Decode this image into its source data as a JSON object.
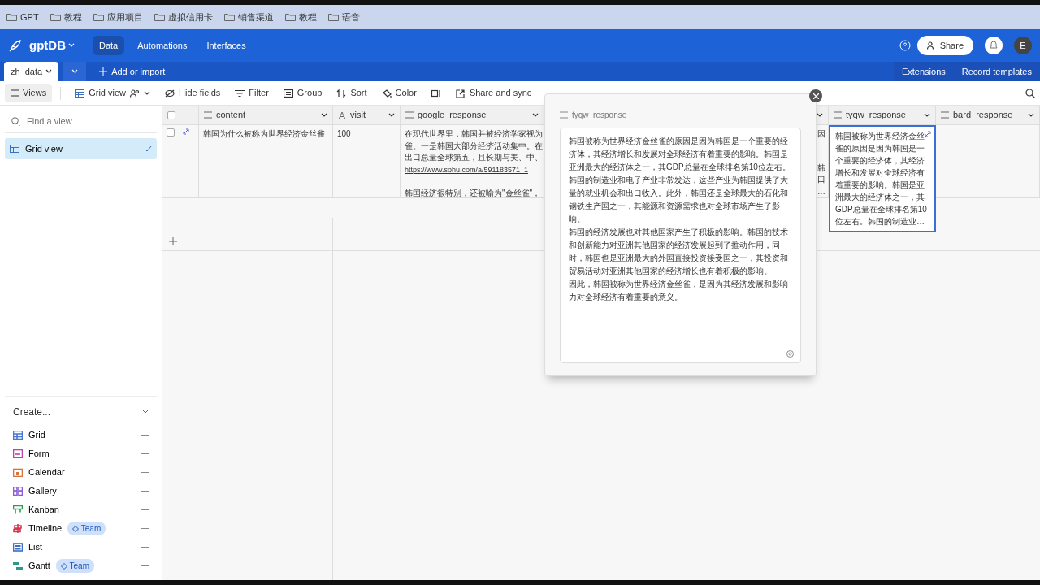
{
  "bookmarks": [
    "GPT",
    "教程",
    "应用项目",
    "虚拟信用卡",
    "销售渠道",
    "教程",
    "语音"
  ],
  "header": {
    "app_name": "gptDB",
    "nav": [
      {
        "label": "Data",
        "selected": true
      },
      {
        "label": "Automations",
        "selected": false
      },
      {
        "label": "Interfaces",
        "selected": false
      }
    ],
    "share": "Share",
    "avatar": "E"
  },
  "tabs_bar": {
    "tabs": [
      {
        "label": "zh_data",
        "selected": true
      }
    ],
    "add": "Add or import",
    "links": [
      "Extensions",
      "Record templates"
    ]
  },
  "toolbar": {
    "views": "Views",
    "view_name": "Grid view",
    "items": [
      {
        "label": "Hide fields",
        "kind": "hide"
      },
      {
        "label": "Filter",
        "kind": "filter"
      },
      {
        "label": "Group",
        "kind": "group"
      },
      {
        "label": "Sort",
        "kind": "sort"
      },
      {
        "label": "Color",
        "kind": "color"
      },
      {
        "label": "Share and sync",
        "kind": "share"
      }
    ]
  },
  "sidebar": {
    "search": {
      "placeholder": "Find a view"
    },
    "views": [
      {
        "label": "Grid view",
        "selected": true
      }
    ],
    "create_title": "Create...",
    "create_items": [
      {
        "label": "Grid",
        "kind": "grid",
        "color": "#4a76d4"
      },
      {
        "label": "Form",
        "kind": "form",
        "color": "#c43fb0"
      },
      {
        "label": "Calendar",
        "kind": "calendar",
        "color": "#d9733b"
      },
      {
        "label": "Gallery",
        "kind": "gallery",
        "color": "#8b5cd6"
      },
      {
        "label": "Kanban",
        "kind": "kanban",
        "color": "#2e9e4f"
      },
      {
        "label": "Timeline",
        "kind": "timeline",
        "color": "#d6364f",
        "badge": "Team"
      },
      {
        "label": "List",
        "kind": "list",
        "color": "#3b6fc4"
      },
      {
        "label": "Gantt",
        "kind": "gantt",
        "color": "#2a9a86",
        "badge": "Team"
      }
    ]
  },
  "table": {
    "columns": [
      {
        "name": "content",
        "kind": "longtext"
      },
      {
        "name": "visit",
        "kind": "text"
      },
      {
        "name": "google_response",
        "kind": "longtext"
      },
      {
        "name": "tyqw_response",
        "kind": "longtext"
      },
      {
        "name": "bard_response",
        "kind": "longtext"
      }
    ],
    "all_checked": false,
    "rows": [
      {
        "checked": false,
        "content": "韩国为什么被称为世界经济金丝雀",
        "visit": "100",
        "google_response": [
          {
            "lines": [
              {
                "text": "在现代世界里，韩国并被经济学家视为",
                "kind": "text"
              },
              {
                "text": "雀。一是韩国大部分经济活动集中。在",
                "kind": "text"
              },
              {
                "text": "出口总量全球第五，且长期与美、中、",
                "kind": "text"
              },
              {
                "text": "https://www.sohu.com/a/591183571_1",
                "kind": "link"
              }
            ]
          },
          {
            "lines": [
              {
                "text": "韩国经济很特别，还被喻为\"金丝雀\"，",
                "kind": "text"
              }
            ]
          }
        ],
        "column_4": [
          "因",
          "韩",
          "口",
          "…"
        ],
        "tyqw_response": {
          "text": "韩国被称为世界经济金丝雀的原因是因为韩国是一个重要的经济体，其经济增长和发展对全球经济有着重要的影响。韩国是亚洲最大的经济体之一，其GDP总量在全球排名第10位左右。韩国的制造业…",
          "selected": true
        }
      }
    ]
  },
  "popup": {
    "field": "tyqw_response",
    "paragraphs": [
      "韩国被称为世界经济金丝雀的原因是因为韩国是一个重要的经济体，其经济增长和发展对全球经济有着重要的影响。韩国是亚洲最大的经济体之一，其GDP总量在全球排名第10位左右。韩国的制造业和电子产业非常发达，这些产业为韩国提供了大量的就业机会和出口收入。此外，韩国还是全球最大的石化和钢铁生产国之一，其能源和资源需求也对全球市场产生了影响。",
      "韩国的经济发展也对其他国家产生了积极的影响。韩国的技术和创新能力对亚洲其他国家的经济发展起到了推动作用，同时，韩国也是亚洲最大的外国直接投资接受国之一，其投资和贸易活动对亚洲其他国家的经济增长也有着积极的影响。",
      "因此，韩国被称为世界经济金丝雀，是因为其经济发展和影响力对全球经济有着重要的意义。"
    ]
  }
}
